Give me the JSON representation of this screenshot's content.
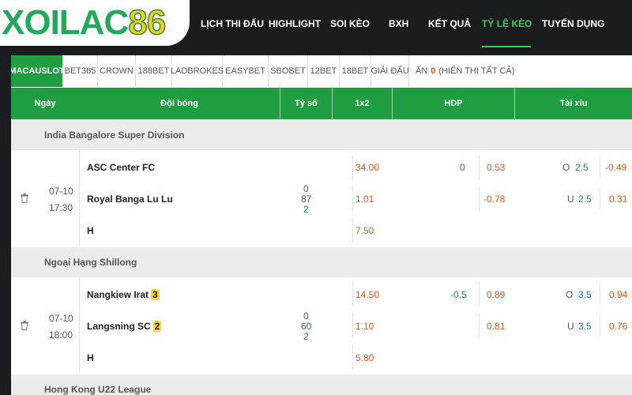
{
  "logo": {
    "part_a": "XOILAC",
    "part_b": "86"
  },
  "nav": [
    {
      "label": "LỊCH THI ĐẤU",
      "active": false
    },
    {
      "label": "HIGHLIGHT",
      "active": false
    },
    {
      "label": "SOI KÈO",
      "active": false
    },
    {
      "label": "BXH",
      "active": false
    },
    {
      "label": "KẾT QUẢ",
      "active": false
    },
    {
      "label": "TỶ LỆ KÈO",
      "active": true
    },
    {
      "label": "TUYỂN DỤNG",
      "active": false
    }
  ],
  "tabs": [
    "MACAUSLOT",
    "BET365",
    "CROWN",
    "188BET",
    "LADBROKES",
    "EASYBET",
    "SBOBET",
    "12BET",
    "18BET",
    "GIẢI ĐẤU"
  ],
  "hidden": {
    "prefix": "ẨN",
    "count": "0",
    "suffix": "(HIỂN THỊ TẤT CẢ)"
  },
  "columns": [
    "Ngày",
    "Đội bóng",
    "Tỷ số",
    "1x2",
    "HDP",
    "Tài xỉu"
  ],
  "leagues": [
    {
      "name": "India Bangalore Super Division",
      "date": "07-10",
      "time": "17:30",
      "home": "ASC Center FC",
      "home_card": "",
      "away": "Royal Banga Lu Lu",
      "away_card": "",
      "draw_label": "H",
      "score_top": "0",
      "score_mid": "87",
      "score_bot": "2",
      "odds_1x2": [
        "34.00",
        "1.01",
        "7.50"
      ],
      "hdp_line": "0",
      "hdp_odds": [
        "0.53",
        "-0.78"
      ],
      "ou_labels": [
        "O",
        "U"
      ],
      "ou_lines": [
        "2.5",
        "2.5"
      ],
      "ou_odds": [
        "-0.49",
        "0.31"
      ]
    },
    {
      "name": "Ngoại Hạng Shillong",
      "date": "07-10",
      "time": "18:00",
      "home": "Nangkiew Irat",
      "home_card": "3",
      "away": "Langsning SC",
      "away_card": "2",
      "draw_label": "H",
      "score_top": "0",
      "score_mid": "60",
      "score_bot": "2",
      "odds_1x2": [
        "14.50",
        "1.10",
        "5.80"
      ],
      "hdp_line": "-0.5",
      "hdp_odds": [
        "0.89",
        "0.81"
      ],
      "ou_labels": [
        "O",
        "U"
      ],
      "ou_lines": [
        "3.5",
        "3.5"
      ],
      "ou_odds": [
        "0.94",
        "0.76"
      ]
    }
  ],
  "next_league": "Hong Kong U22 League",
  "colors": {
    "accent_green": "#1f9d41",
    "active_nav": "#3ec96a",
    "odds_orange": "#d65a1f",
    "odds_blue": "#1d6fb8",
    "card_yellow": "#f6d33a"
  }
}
